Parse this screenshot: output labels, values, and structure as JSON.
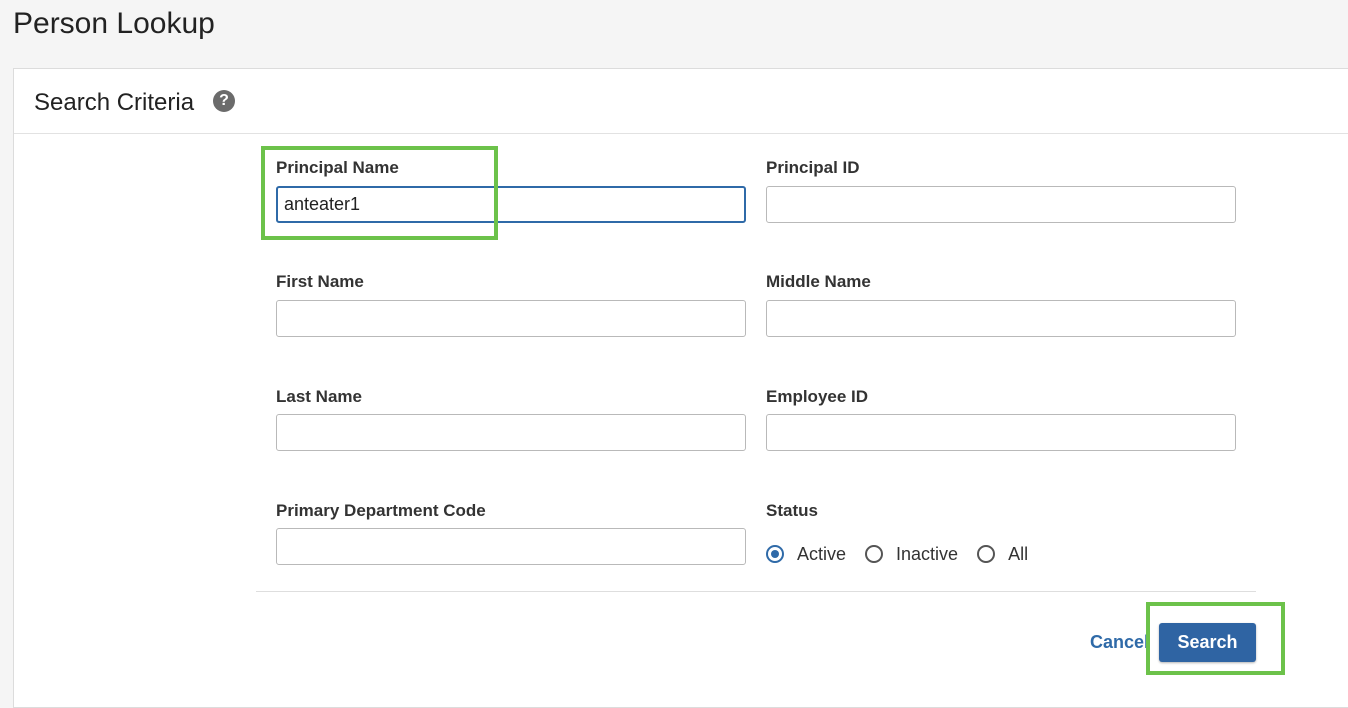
{
  "page": {
    "title": "Person Lookup"
  },
  "panel": {
    "title": "Search Criteria",
    "help_icon": "help-icon",
    "help_glyph": "?"
  },
  "fields": {
    "principal_name": {
      "label": "Principal Name",
      "value": "anteater1"
    },
    "principal_id": {
      "label": "Principal ID",
      "value": ""
    },
    "first_name": {
      "label": "First Name",
      "value": ""
    },
    "middle_name": {
      "label": "Middle Name",
      "value": ""
    },
    "last_name": {
      "label": "Last Name",
      "value": ""
    },
    "employee_id": {
      "label": "Employee ID",
      "value": ""
    },
    "primary_department_code": {
      "label": "Primary Department Code",
      "value": ""
    }
  },
  "status": {
    "label": "Status",
    "options": [
      "Active",
      "Inactive",
      "All"
    ],
    "selected": "Active"
  },
  "actions": {
    "cancel_label": "Cancel",
    "search_label": "Search"
  },
  "colors": {
    "accent": "#2f64a3",
    "highlight": "#6cc24a"
  }
}
